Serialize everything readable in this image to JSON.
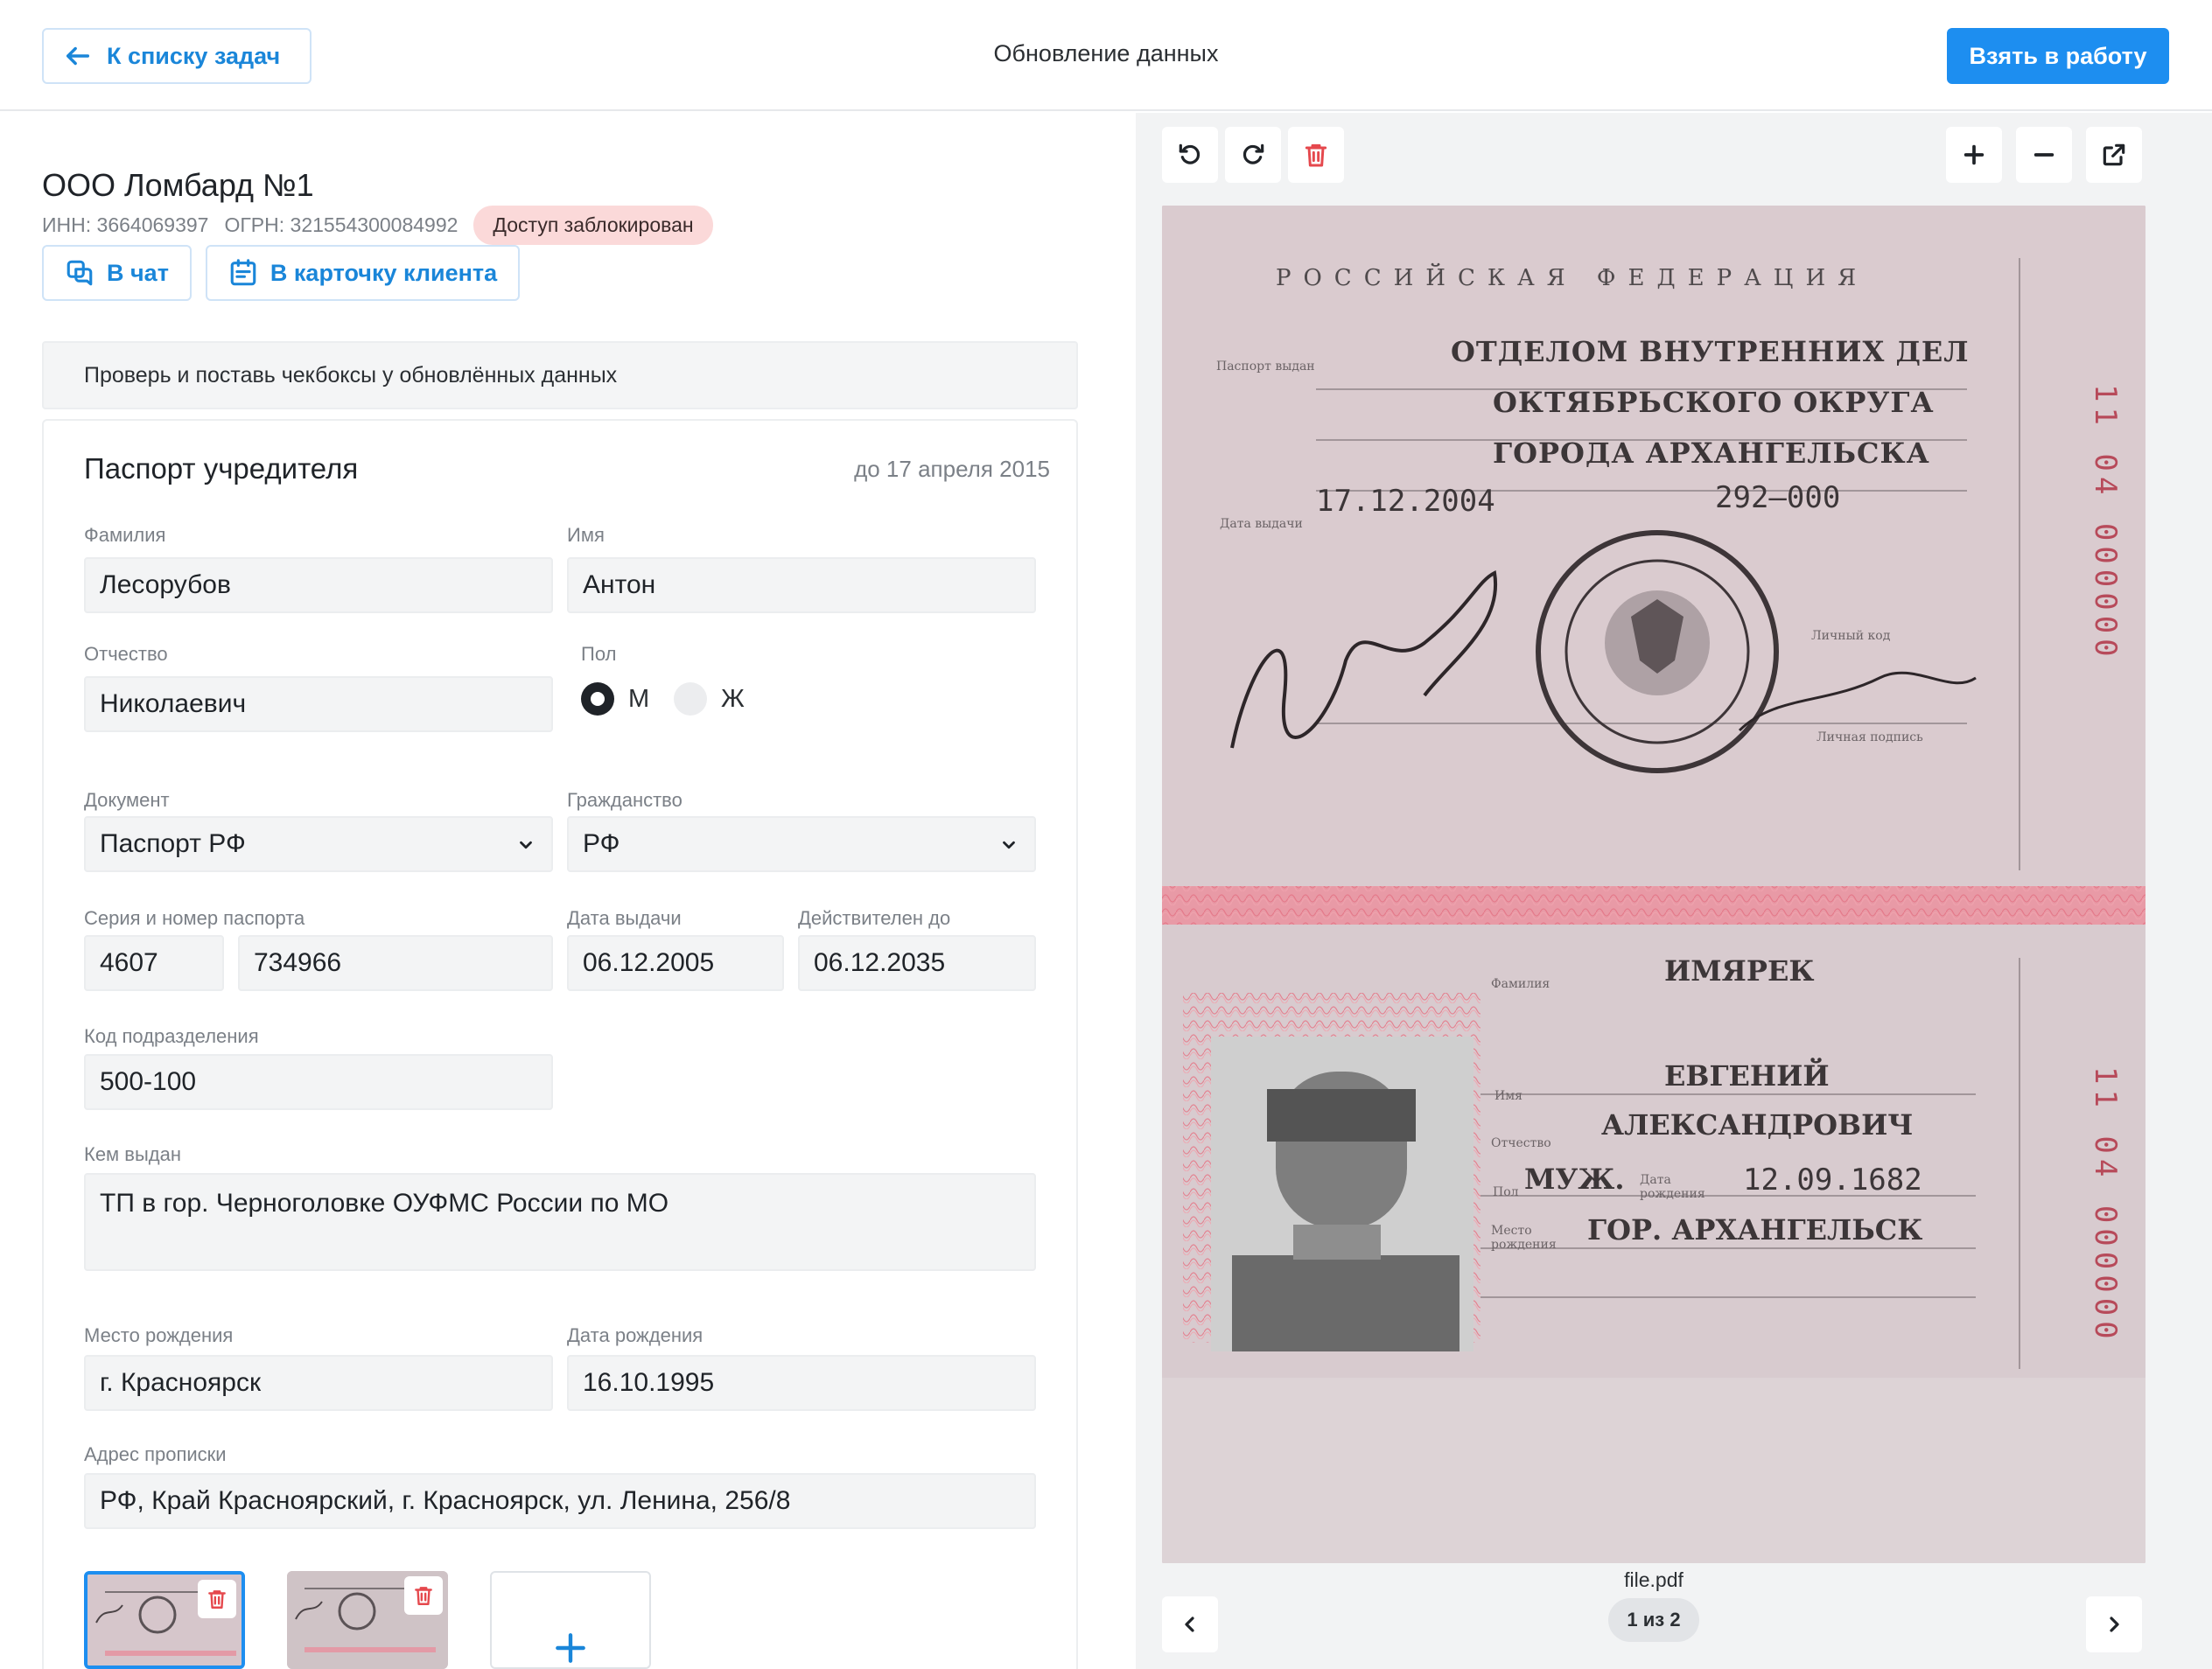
{
  "header": {
    "back_label": "К списку задач",
    "title": "Обновление данных",
    "take_label": "Взять в работу"
  },
  "client": {
    "name": "ООО Ломбард №1",
    "inn": "ИНН:  3664069397",
    "ogrn": "ОГРН: 321554300084992",
    "status": "Доступ заблокирован",
    "chat_label": "В чат",
    "card_label": "В карточку клиента"
  },
  "hint": "Проверь и поставь чекбоксы у обновлённых данных",
  "passport": {
    "title": "Паспорт учредителя",
    "due": "до 17 апреля 2015",
    "surname_label": "Фамилия",
    "surname": "Лесорубов",
    "name_label": "Имя",
    "name": "Антон",
    "patronymic_label": "Отчество",
    "patronymic": "Николаевич",
    "gender_label": "Пол",
    "gender_m": "М",
    "gender_f": "Ж",
    "gender_selected": "М",
    "doc_label": "Документ",
    "doc": "Паспорт РФ",
    "citizenship_label": "Гражданство",
    "citizenship": "РФ",
    "series_label": "Серия и номер паспорта",
    "series": "4607",
    "number": "734966",
    "issue_label": "Дата выдачи",
    "issue": "06.12.2005",
    "valid_label": "Действителен до",
    "valid": "06.12.2035",
    "code_label": "Код подразделения",
    "code": "500-100",
    "issuer_label": "Кем выдан",
    "issuer": "ТП в гор. Черноголовке ОУФМС России по МО",
    "birthplace_label": "Место рождения",
    "birthplace": "г. Красноярск",
    "birthdate_label": "Дата рождения",
    "birthdate": "16.10.1995",
    "address_label": "Адрес прописки",
    "address": "РФ, Край Красноярский, г. Красноярск, ул. Ленина, 256/8"
  },
  "scan": {
    "country": "РОССИЙСКАЯ   ФЕДЕРАЦИЯ",
    "issued_by_caption": "Паспорт выдан",
    "issued_line1": "ОТДЕЛОМ ВНУТРЕННИХ ДЕЛ",
    "issued_line2": "ОКТЯБРЬСКОГО ОКРУГА",
    "issued_line3": "ГОРОДА АРХАНГЕЛЬСКА",
    "issue_date": "17.12.2004",
    "dept_code": "292–000",
    "issue_date_caption": "Дата выдачи",
    "personal_code_caption": "Личный код",
    "personal_sign_caption": "Личная подпись",
    "serial_top": "11  04  000000",
    "surname_caption": "Фамилия",
    "surname": "ИМЯРЕК",
    "name_caption": "Имя",
    "name": "ЕВГЕНИЙ",
    "patronymic_caption": "Отчество",
    "patronymic": "АЛЕКСАНДРОВИЧ",
    "sex_caption": "Пол",
    "sex": "МУЖ.",
    "birthdate_caption": "Дата рождения",
    "birthdate": "12.09.1682",
    "birthplace_caption": "Место рождения",
    "birthplace": "ГОР. АРХАНГЕЛЬСК",
    "serial_bottom": "11  04  000000",
    "filename": "file.pdf",
    "page": "1 из 2"
  },
  "icons": [
    "arrow-left-icon",
    "chat-icon",
    "id-card-icon",
    "rotate-left-icon",
    "rotate-right-icon",
    "trash-icon",
    "plus-icon",
    "minus-icon",
    "external-link-icon",
    "chevron-down-icon",
    "chevron-left-icon",
    "chevron-right-icon"
  ],
  "colors": {
    "accent": "#1d8ef0",
    "danger": "#e5484d",
    "badge": "#fbd9d9"
  }
}
